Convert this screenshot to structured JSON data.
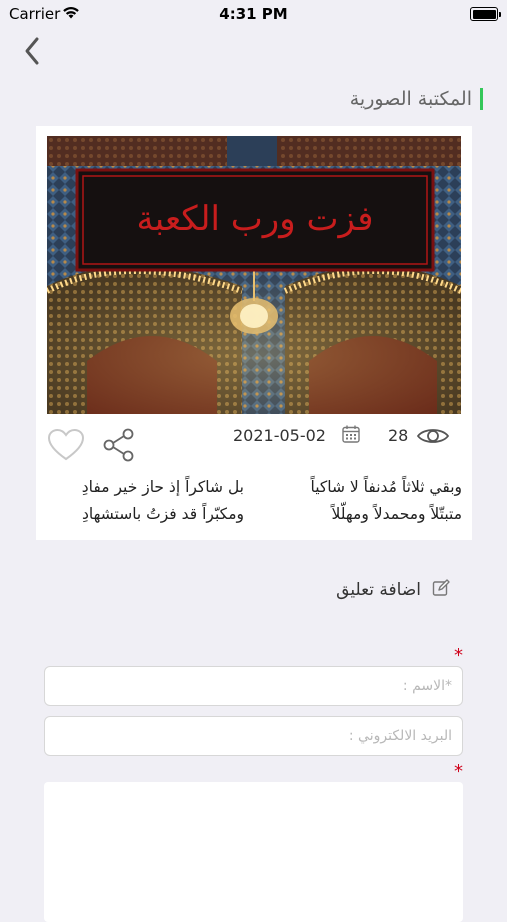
{
  "status_bar": {
    "carrier": "Carrier",
    "time": "4:31 PM"
  },
  "header": {
    "section_title": "المكتبة الصورية",
    "accent_color": "#34c759"
  },
  "post": {
    "image": {
      "banner_text": "فزت ورب الكعبة"
    },
    "views": "28",
    "date": "2021-05-02",
    "poem": {
      "right_lines": [
        "وبقي ثلاثاً مُدنفاً لا شاكياً",
        "متبتّلاً ومحمدلاً ومهلّلاً"
      ],
      "left_lines": [
        "بل شاكراً إذ حاز خير مفادِ",
        "ومكبّراً قد فزتُ باستشهادِ"
      ]
    }
  },
  "comment_form": {
    "title": "اضافة تعليق",
    "required_mark": "*",
    "name_placeholder": "*الاسم :",
    "email_placeholder": "البريد الالكتروني :"
  },
  "icons": [
    "back-icon",
    "heart-icon",
    "share-icon",
    "calendar-icon",
    "eye-icon",
    "edit-icon"
  ]
}
